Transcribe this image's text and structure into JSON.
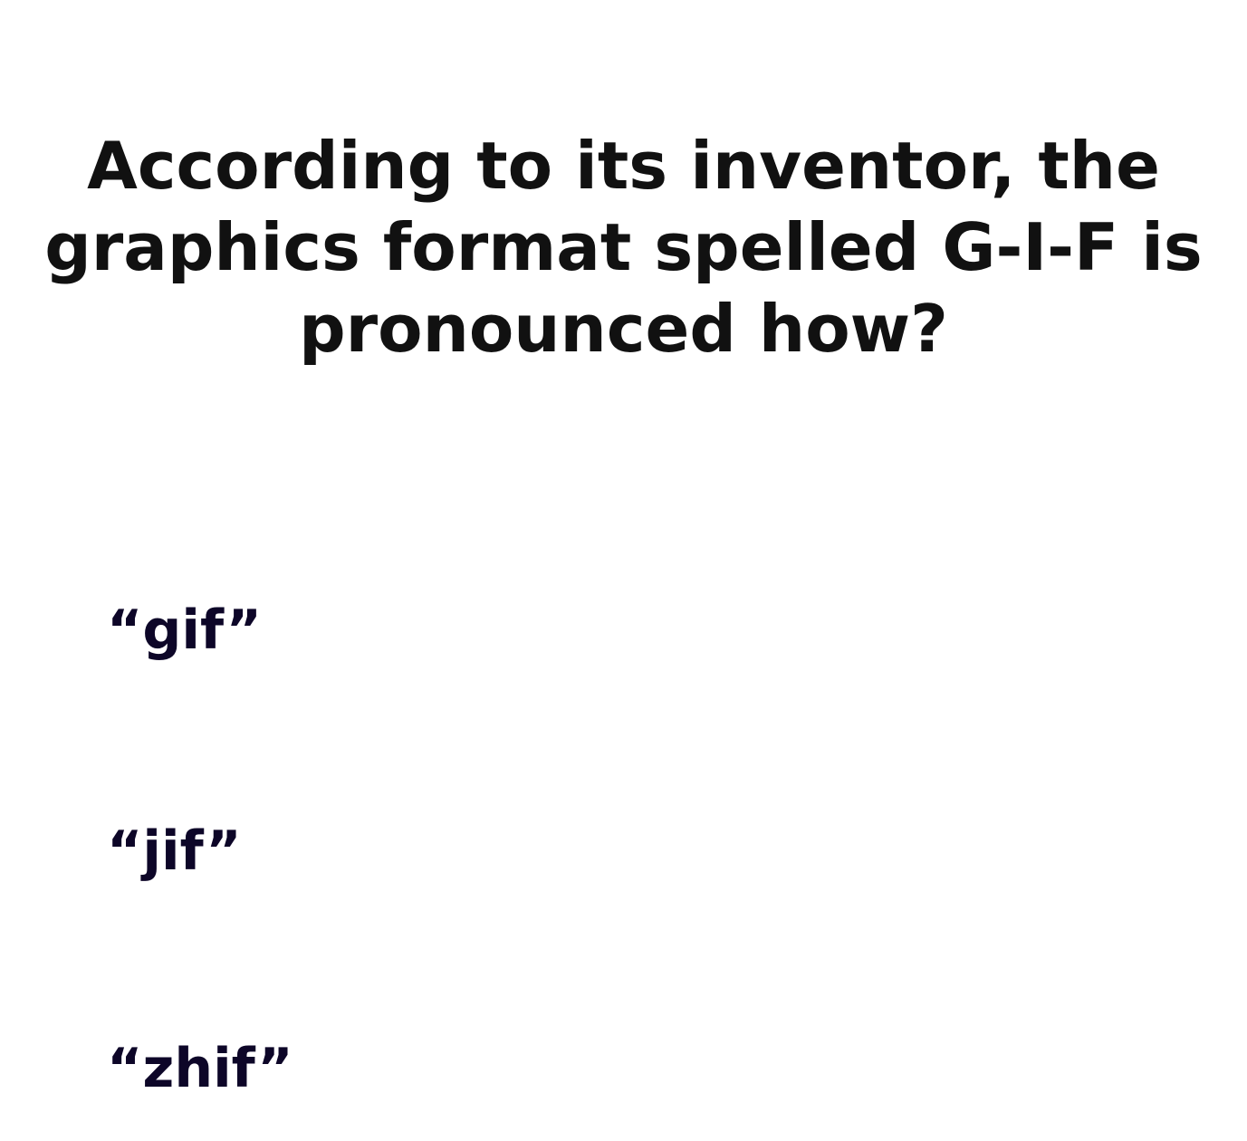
{
  "quiz": {
    "question": "According to its inventor, the graphics format spelled G-I-F is pronounced how?",
    "options": [
      {
        "label": "“gif”"
      },
      {
        "label": "“jif”"
      },
      {
        "label": "“zhif”"
      }
    ]
  },
  "colors": {
    "question_text": "#111111",
    "option_text": "#0d0628",
    "background": "#ffffff"
  }
}
